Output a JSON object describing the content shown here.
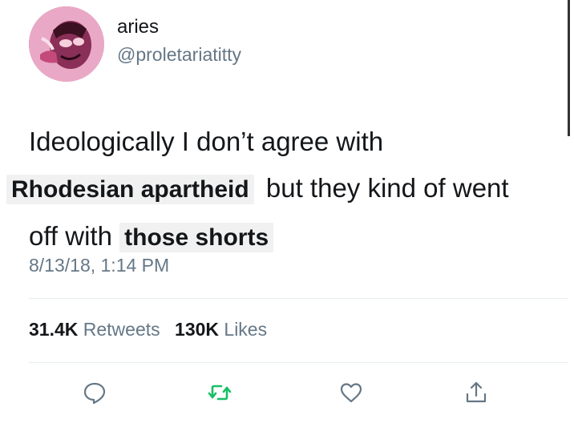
{
  "user": {
    "display_name": "aries",
    "handle": "@proletariatitty"
  },
  "tweet": {
    "line1": "Ideologically I don’t agree with",
    "line2_bold": "Rhodesian apartheid",
    "line2_rest": "but they kind of went",
    "line3_start": "off with",
    "line3_bold": "those shorts",
    "timestamp": "8/13/18, 1:14 PM"
  },
  "stats": {
    "retweets_count": "31.4K",
    "retweets_label": "Retweets",
    "likes_count": "130K",
    "likes_label": "Likes"
  },
  "actions": {
    "reply_icon": "reply-icon",
    "retweet_icon": "retweet-icon",
    "like_icon": "heart-icon",
    "share_icon": "share-icon"
  },
  "colors": {
    "secondary_text": "#657786",
    "primary_text": "#14171a",
    "retweet_accent": "#17bf63",
    "highlight_bg": "#f1f1f1"
  }
}
